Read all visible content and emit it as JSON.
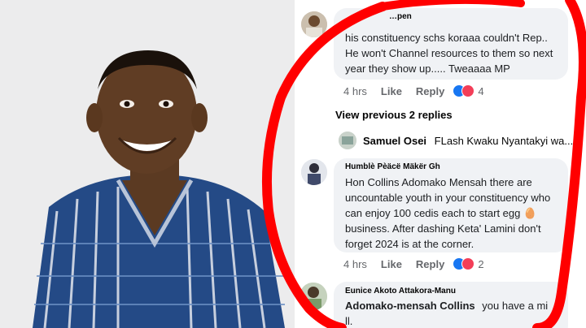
{
  "comments": [
    {
      "author": "",
      "author_partial": "…pen",
      "text_lines": [
        "his constituency schs koraaa couldn't Rep..",
        "He won't Channel resources to them so next",
        "year they show up..... Tweaaaa MP"
      ],
      "time": "4 hrs",
      "like": "Like",
      "reply": "Reply",
      "reaction_count": "4"
    },
    {
      "author": "Humblè Pèäcë Mäkër Gh",
      "text_lines": [
        "Hon Collins Adomako Mensah  there are",
        "uncountable youth in your constituency who",
        "can enjoy 100 cedis each to start egg 🥚",
        "business. After dashing Keta' Lamini don't",
        "forget 2024 is at the corner."
      ],
      "time": "4 hrs",
      "like": "Like",
      "reply": "Reply",
      "reaction_count": "2"
    },
    {
      "author": "Eunice Akoto Attakora-Manu",
      "mention": "Adomako-mensah Collins",
      "text_lines": [
        "you have a mi",
        "ll."
      ]
    }
  ],
  "view_previous": "View previous 2 replies",
  "reply_preview": {
    "name": "Samuel Osei",
    "text": "FLash Kwaku Nyantakyi wa..."
  },
  "colors": {
    "bubble": "#f0f2f5",
    "link_blue": "#1877f2",
    "red_marker": "#ff0000",
    "kente_blue": "#2f5d9a"
  }
}
